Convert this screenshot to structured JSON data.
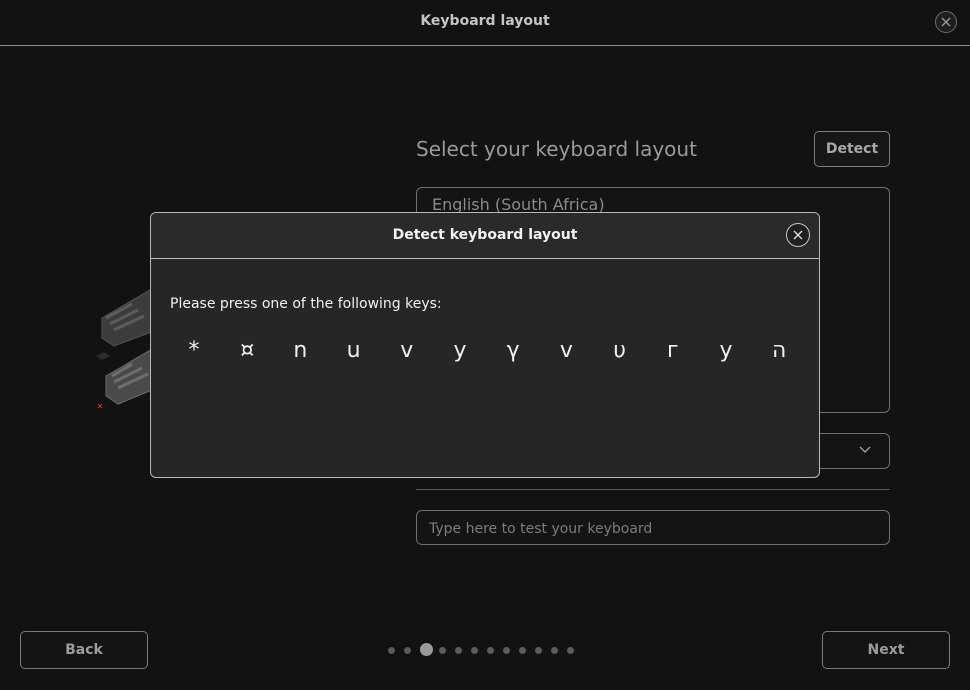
{
  "window": {
    "title": "Keyboard layout"
  },
  "main": {
    "heading": "Select your keyboard layout",
    "detect_label": "Detect",
    "layout_item": "English (South Africa)",
    "test_placeholder": "Type here to test your keyboard"
  },
  "dialog": {
    "title": "Detect keyboard layout",
    "prompt": "Please press one of the following keys:",
    "keys": [
      "*",
      "¤",
      "n",
      "u",
      "v",
      "y",
      "γ",
      "v",
      "υ",
      "г",
      "y",
      "ה"
    ]
  },
  "footer": {
    "back_label": "Back",
    "next_label": "Next",
    "steps_total": 12,
    "current_step": 3
  },
  "icons": {
    "window_close": "close-icon",
    "dialog_close": "close-icon",
    "combo": "chevron-down-icon"
  }
}
